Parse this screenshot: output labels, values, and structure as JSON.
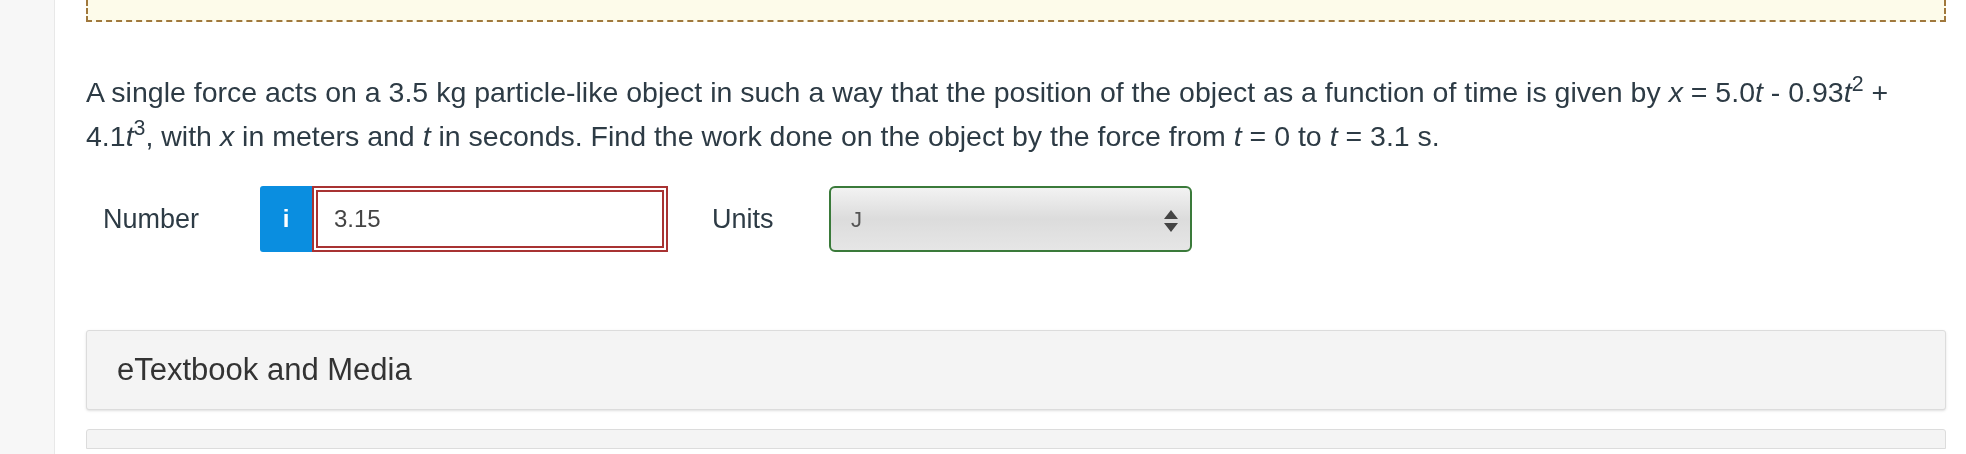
{
  "question": {
    "segments": [
      {
        "kind": "plain",
        "text": "A single force acts on a 3.5 kg particle-like object in such a way that the position of the object as a function of time is given by "
      },
      {
        "kind": "italic",
        "text": "x"
      },
      {
        "kind": "plain",
        "text": " = 5.0"
      },
      {
        "kind": "italic",
        "text": "t"
      },
      {
        "kind": "plain",
        "text": " - 0.93"
      },
      {
        "kind": "italic",
        "text": "t"
      },
      {
        "kind": "sup",
        "text": "2"
      },
      {
        "kind": "plain",
        "text": " + 4.1"
      },
      {
        "kind": "italic",
        "text": "t"
      },
      {
        "kind": "sup",
        "text": "3"
      },
      {
        "kind": "plain",
        "text": ", with "
      },
      {
        "kind": "italic",
        "text": "x"
      },
      {
        "kind": "plain",
        "text": " in meters and "
      },
      {
        "kind": "italic",
        "text": "t"
      },
      {
        "kind": "plain",
        "text": " in seconds. Find the work done on the object by the force from "
      },
      {
        "kind": "italic",
        "text": "t"
      },
      {
        "kind": "plain",
        "text": " = 0 to "
      },
      {
        "kind": "italic",
        "text": "t"
      },
      {
        "kind": "plain",
        "text": " = 3.1 s."
      }
    ]
  },
  "answer": {
    "number_label": "Number",
    "info_button": "i",
    "number_value": "3.15",
    "number_correct": false,
    "units_label": "Units",
    "units_value": "J",
    "units_correct": true
  },
  "panels": [
    {
      "title": "eTextbook and Media"
    }
  ]
}
